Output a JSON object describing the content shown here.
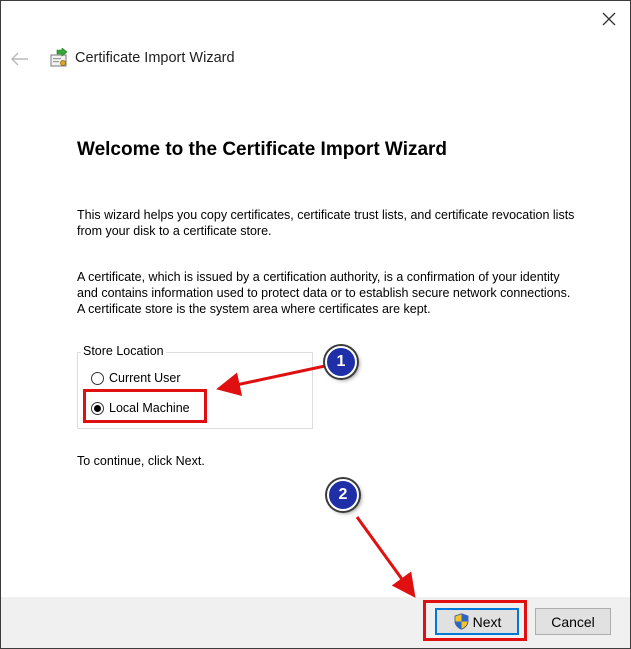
{
  "window": {
    "title": "Certificate Import Wizard",
    "close_icon": "close-icon",
    "back_icon": "back-arrow-icon",
    "title_icon": "certificate-icon"
  },
  "content": {
    "heading": "Welcome to the Certificate Import Wizard",
    "paragraph1": "This wizard helps you copy certificates, certificate trust lists, and certificate revocation lists from your disk to a certificate store.",
    "paragraph2": "A certificate, which is issued by a certification authority, is a confirmation of your identity and contains information used to protect data or to establish secure network connections. A certificate store is the system area where certificates are kept.",
    "store_location": {
      "legend": "Store Location",
      "options": [
        {
          "label": "Current User",
          "selected": false
        },
        {
          "label": "Local Machine",
          "selected": true
        }
      ]
    },
    "continue_text": "To continue, click Next."
  },
  "footer": {
    "next_label": "Next",
    "cancel_label": "Cancel",
    "shield_icon": "uac-shield-icon"
  },
  "annotations": {
    "badge1": "1",
    "badge2": "2",
    "color": "#e01010",
    "badge_color": "#1e2fa8"
  }
}
